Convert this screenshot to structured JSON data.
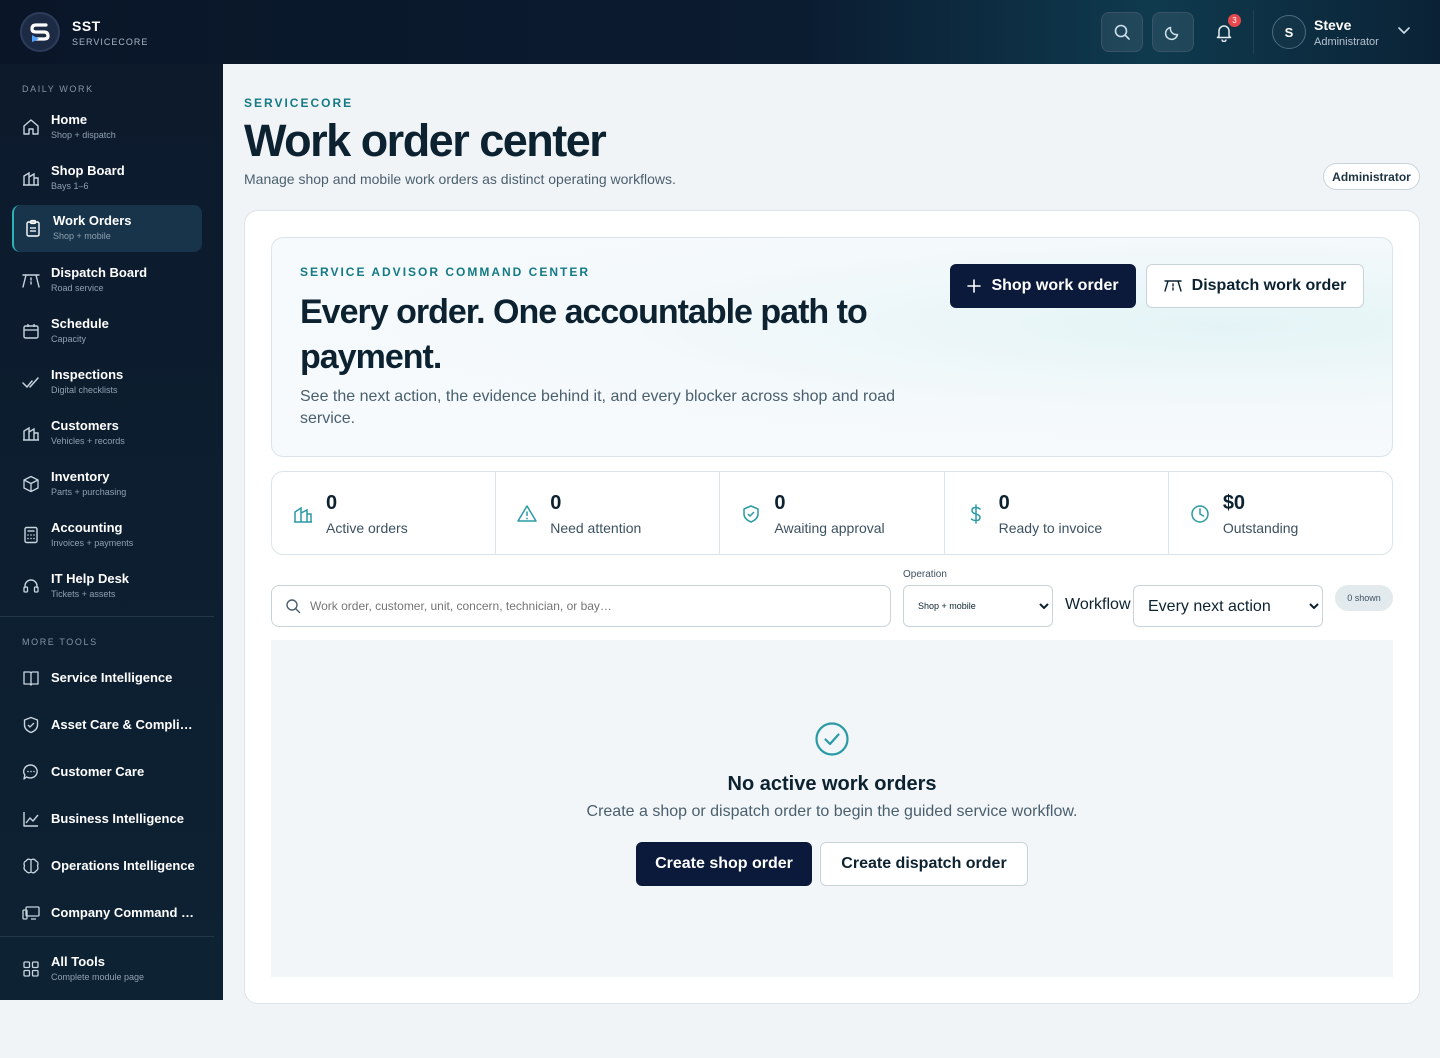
{
  "brand": {
    "name": "SST",
    "sub": "SERVICECORE"
  },
  "topbar": {
    "notifications": "3",
    "user_initial": "S",
    "user_name": "Steve",
    "user_role": "Administrator"
  },
  "sidebar": {
    "daily_title": "DAILY WORK",
    "daily": [
      {
        "label": "Home",
        "sub": "Shop + dispatch",
        "icon": "home-icon"
      },
      {
        "label": "Shop Board",
        "sub": "Bays 1–6",
        "icon": "building-icon"
      },
      {
        "label": "Work Orders",
        "sub": "Shop + mobile",
        "icon": "clipboard-icon"
      },
      {
        "label": "Dispatch Board",
        "sub": "Road service",
        "icon": "road-icon"
      },
      {
        "label": "Schedule",
        "sub": "Capacity",
        "icon": "calendar-icon"
      },
      {
        "label": "Inspections",
        "sub": "Digital checklists",
        "icon": "check-icon"
      },
      {
        "label": "Customers",
        "sub": "Vehicles + records",
        "icon": "building-icon"
      },
      {
        "label": "Inventory",
        "sub": "Parts + purchasing",
        "icon": "box-icon"
      },
      {
        "label": "Accounting",
        "sub": "Invoices + payments",
        "icon": "calculator-icon"
      },
      {
        "label": "IT Help Desk",
        "sub": "Tickets + assets",
        "icon": "headset-icon"
      }
    ],
    "more_title": "MORE TOOLS",
    "more": [
      {
        "label": "Service Intelligence",
        "icon": "book-icon"
      },
      {
        "label": "Asset Care & Compliance",
        "icon": "shield-icon"
      },
      {
        "label": "Customer Care",
        "icon": "chat-icon"
      },
      {
        "label": "Business Intelligence",
        "icon": "trend-icon"
      },
      {
        "label": "Operations Intelligence",
        "icon": "brain-icon"
      },
      {
        "label": "Company Command Center",
        "icon": "monitor-icon"
      }
    ],
    "all_tools": {
      "label": "All Tools",
      "sub": "Complete module page"
    }
  },
  "header": {
    "kicker": "SERVICECORE",
    "title": "Work order center",
    "subtitle": "Manage shop and mobile work orders as distinct operating workflows.",
    "role": "Administrator"
  },
  "hero": {
    "kicker": "SERVICE ADVISOR COMMAND CENTER",
    "title": "Every order. One accountable path to payment.",
    "subtitle": "See the next action, the evidence behind it, and every blocker across shop and road service.",
    "primary": "Shop work order",
    "secondary": "Dispatch work order"
  },
  "stats": [
    {
      "value": "0",
      "label": "Active orders",
      "icon": "building-icon"
    },
    {
      "value": "0",
      "label": "Need attention",
      "icon": "warning-icon"
    },
    {
      "value": "0",
      "label": "Awaiting approval",
      "icon": "shield-check-icon"
    },
    {
      "value": "0",
      "label": "Ready to invoice",
      "icon": "dollar-icon"
    },
    {
      "value": "$0",
      "label": "Outstanding",
      "icon": "clock-icon"
    }
  ],
  "filters": {
    "search_placeholder": "Work order, customer, unit, concern, technician, or bay…",
    "operation_label": "Operation",
    "operation_value": "Shop + mobile",
    "workflow_label": "Workflow",
    "workflow_value": "Every next action",
    "shown": "0 shown"
  },
  "empty": {
    "title": "No active work orders",
    "subtitle": "Create a shop or dispatch order to begin the guided service workflow.",
    "primary": "Create shop order",
    "secondary": "Create dispatch order"
  },
  "colors": {
    "accent": "#147a86",
    "navy": "#0b1a3a",
    "sidebar": "#0c1a2c"
  }
}
